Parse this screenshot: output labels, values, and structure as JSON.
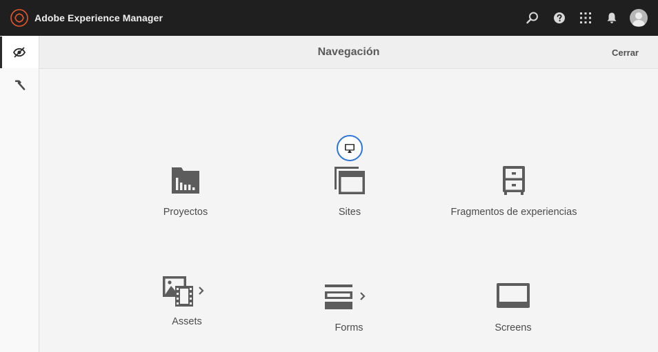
{
  "app": {
    "title": "Adobe Experience Manager",
    "accent": "#e8582c",
    "topbar_icons": [
      "search-icon",
      "help-icon",
      "solutions-grid-icon",
      "notifications-bell-icon",
      "user-avatar"
    ]
  },
  "rail": {
    "items": [
      {
        "name": "navigation-icon",
        "active": true
      },
      {
        "name": "tools-hammer-icon",
        "active": false
      }
    ]
  },
  "navigation": {
    "title": "Navegación",
    "close_label": "Cerrar"
  },
  "tiles": [
    {
      "label": "Proyectos",
      "icon": "projects-folder-icon"
    },
    {
      "label": "Sites",
      "icon": "sites-pages-icon",
      "badge_icon": "desktop-monitor-icon"
    },
    {
      "label": "Fragmentos de experiencias",
      "icon": "experience-fragments-cabinet-icon"
    },
    {
      "label": "Assets",
      "icon": "assets-media-icon",
      "has_submenu": true
    },
    {
      "label": "Forms",
      "icon": "forms-icon",
      "has_submenu": true
    },
    {
      "label": "Screens",
      "icon": "screens-monitor-icon"
    }
  ],
  "colors": {
    "topbar_bg": "#1f1f1f",
    "focus_ring": "#2b74d8",
    "icon_gray": "#5c5c5c"
  }
}
